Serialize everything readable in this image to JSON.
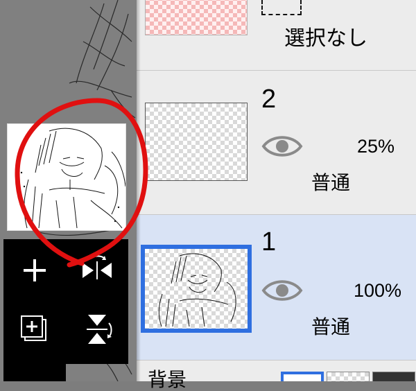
{
  "layers": [
    {
      "name": "2",
      "opacity": "25%",
      "blend": "普通",
      "visible": true,
      "selected": false
    },
    {
      "name": "1",
      "opacity": "100%",
      "blend": "普通",
      "visible": true,
      "selected": true
    }
  ],
  "selection_layer": {
    "label": "選択なし"
  },
  "background_row": {
    "label": "背景"
  },
  "colors": {
    "selection_border": "#2f6fe0",
    "selected_row_bg": "#d9e3f5",
    "annotation_red": "#e01010",
    "eye_icon": "#8a8a8a"
  },
  "toolbox": {
    "icons": [
      "add-layer-icon",
      "flip-horizontal-icon",
      "add-folder-icon",
      "flip-vertical-icon"
    ]
  }
}
